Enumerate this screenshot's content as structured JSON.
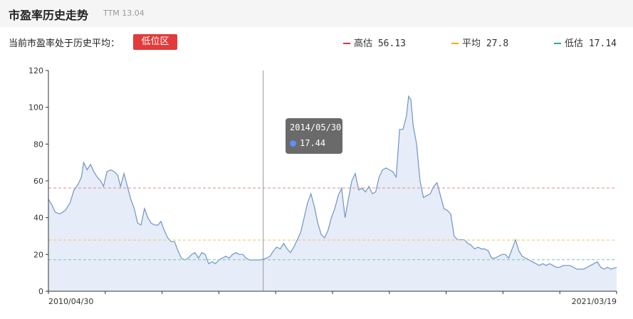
{
  "header": {
    "title": "市盈率历史走势",
    "ttm": "TTM 13.04"
  },
  "status": {
    "text": "当前市盈率处于历史平均：",
    "badge": "低位区",
    "badge_color": "#e23b3b"
  },
  "legend": [
    {
      "label": "高估",
      "value": "56.13",
      "color": "#d9363e"
    },
    {
      "label": "平均",
      "value": "27.8",
      "color": "#f5a623"
    },
    {
      "label": "低估",
      "value": "17.14",
      "color": "#2bb673"
    }
  ],
  "tooltip": {
    "date": "2014/05/30",
    "value": "17.44",
    "dot_color": "#5b8ff9"
  },
  "chart_data": {
    "type": "area",
    "x_start": "2010/04/30",
    "x_end": "2021/03/19",
    "ylim": [
      0,
      120
    ],
    "yticks": [
      0,
      20,
      40,
      60,
      80,
      100,
      120
    ],
    "xtick_labels": [
      "2010/04/30",
      "2021/03/19"
    ],
    "line_color": "#6f95c4",
    "fill_color": "#e6ecf8",
    "reference_lines": [
      {
        "name": "高估",
        "value": 56.13,
        "color": "#e08a8a"
      },
      {
        "name": "平均",
        "value": 27.8,
        "color": "#f2c16b"
      },
      {
        "name": "低估",
        "value": 17.14,
        "color": "#6cc8b8"
      }
    ],
    "crosshair_x": 0.378,
    "series": [
      {
        "values": [
          [
            0.0,
            50
          ],
          [
            0.006,
            47
          ],
          [
            0.012,
            43
          ],
          [
            0.02,
            42
          ],
          [
            0.03,
            44
          ],
          [
            0.038,
            48
          ],
          [
            0.045,
            55
          ],
          [
            0.052,
            58
          ],
          [
            0.058,
            62
          ],
          [
            0.062,
            70
          ],
          [
            0.068,
            66
          ],
          [
            0.074,
            69
          ],
          [
            0.08,
            65
          ],
          [
            0.086,
            62
          ],
          [
            0.092,
            60
          ],
          [
            0.097,
            57
          ],
          [
            0.103,
            65
          ],
          [
            0.11,
            66
          ],
          [
            0.116,
            65
          ],
          [
            0.122,
            63
          ],
          [
            0.127,
            57
          ],
          [
            0.133,
            64
          ],
          [
            0.139,
            57
          ],
          [
            0.145,
            50
          ],
          [
            0.151,
            45
          ],
          [
            0.157,
            37
          ],
          [
            0.163,
            36
          ],
          [
            0.169,
            45
          ],
          [
            0.175,
            40
          ],
          [
            0.181,
            37
          ],
          [
            0.187,
            36
          ],
          [
            0.193,
            36
          ],
          [
            0.198,
            38
          ],
          [
            0.204,
            33
          ],
          [
            0.21,
            29
          ],
          [
            0.216,
            27
          ],
          [
            0.222,
            27
          ],
          [
            0.228,
            22
          ],
          [
            0.234,
            18
          ],
          [
            0.24,
            17
          ],
          [
            0.246,
            18
          ],
          [
            0.252,
            20
          ],
          [
            0.258,
            21
          ],
          [
            0.264,
            18
          ],
          [
            0.27,
            21
          ],
          [
            0.276,
            20
          ],
          [
            0.282,
            15
          ],
          [
            0.288,
            16
          ],
          [
            0.294,
            15
          ],
          [
            0.3,
            17
          ],
          [
            0.306,
            18
          ],
          [
            0.312,
            19
          ],
          [
            0.318,
            18
          ],
          [
            0.324,
            20
          ],
          [
            0.33,
            21
          ],
          [
            0.336,
            20
          ],
          [
            0.342,
            20
          ],
          [
            0.348,
            18
          ],
          [
            0.354,
            17
          ],
          [
            0.36,
            17
          ],
          [
            0.366,
            17
          ],
          [
            0.372,
            17
          ],
          [
            0.378,
            17.44
          ],
          [
            0.384,
            18
          ],
          [
            0.39,
            19
          ],
          [
            0.396,
            22
          ],
          [
            0.402,
            24
          ],
          [
            0.408,
            23
          ],
          [
            0.414,
            26
          ],
          [
            0.42,
            23
          ],
          [
            0.426,
            21
          ],
          [
            0.432,
            24
          ],
          [
            0.438,
            28
          ],
          [
            0.444,
            32
          ],
          [
            0.45,
            40
          ],
          [
            0.456,
            48
          ],
          [
            0.462,
            53
          ],
          [
            0.468,
            46
          ],
          [
            0.474,
            37
          ],
          [
            0.48,
            31
          ],
          [
            0.486,
            29
          ],
          [
            0.492,
            33
          ],
          [
            0.498,
            40
          ],
          [
            0.504,
            45
          ],
          [
            0.51,
            52
          ],
          [
            0.516,
            56
          ],
          [
            0.522,
            40
          ],
          [
            0.528,
            50
          ],
          [
            0.534,
            60
          ],
          [
            0.54,
            64
          ],
          [
            0.546,
            55
          ],
          [
            0.552,
            56
          ],
          [
            0.558,
            54
          ],
          [
            0.564,
            57
          ],
          [
            0.57,
            53
          ],
          [
            0.576,
            54
          ],
          [
            0.582,
            62
          ],
          [
            0.588,
            66
          ],
          [
            0.594,
            67
          ],
          [
            0.6,
            66
          ],
          [
            0.606,
            65
          ],
          [
            0.612,
            62
          ],
          [
            0.618,
            88
          ],
          [
            0.624,
            88
          ],
          [
            0.63,
            95
          ],
          [
            0.634,
            106
          ],
          [
            0.638,
            104
          ],
          [
            0.642,
            90
          ],
          [
            0.648,
            80
          ],
          [
            0.654,
            60
          ],
          [
            0.66,
            51
          ],
          [
            0.666,
            52
          ],
          [
            0.672,
            53
          ],
          [
            0.678,
            57
          ],
          [
            0.684,
            59
          ],
          [
            0.69,
            52
          ],
          [
            0.696,
            45
          ],
          [
            0.702,
            44
          ],
          [
            0.708,
            42
          ],
          [
            0.714,
            30
          ],
          [
            0.72,
            28
          ],
          [
            0.726,
            28
          ],
          [
            0.732,
            28
          ],
          [
            0.738,
            26
          ],
          [
            0.744,
            25
          ],
          [
            0.75,
            23
          ],
          [
            0.756,
            24
          ],
          [
            0.762,
            23
          ],
          [
            0.768,
            23
          ],
          [
            0.774,
            22
          ],
          [
            0.78,
            18
          ],
          [
            0.786,
            18
          ],
          [
            0.792,
            19
          ],
          [
            0.798,
            20
          ],
          [
            0.804,
            20
          ],
          [
            0.81,
            18
          ],
          [
            0.816,
            23
          ],
          [
            0.822,
            28
          ],
          [
            0.828,
            22
          ],
          [
            0.834,
            19
          ],
          [
            0.84,
            18
          ],
          [
            0.846,
            17
          ],
          [
            0.852,
            16
          ],
          [
            0.858,
            15
          ],
          [
            0.864,
            14
          ],
          [
            0.87,
            15
          ],
          [
            0.876,
            14
          ],
          [
            0.882,
            15
          ],
          [
            0.888,
            14
          ],
          [
            0.894,
            13
          ],
          [
            0.9,
            13
          ],
          [
            0.906,
            14
          ],
          [
            0.912,
            14
          ],
          [
            0.918,
            14
          ],
          [
            0.924,
            13
          ],
          [
            0.93,
            12
          ],
          [
            0.936,
            12
          ],
          [
            0.942,
            12
          ],
          [
            0.948,
            13
          ],
          [
            0.954,
            14
          ],
          [
            0.96,
            15
          ],
          [
            0.966,
            16
          ],
          [
            0.972,
            13
          ],
          [
            0.978,
            12
          ],
          [
            0.984,
            13
          ],
          [
            0.99,
            12
          ],
          [
            1.0,
            13
          ]
        ]
      }
    ]
  }
}
